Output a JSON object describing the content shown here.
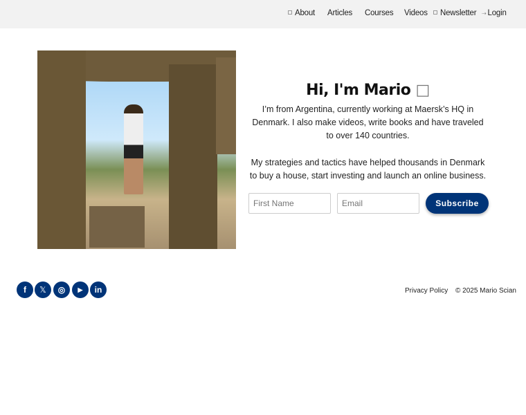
{
  "nav": {
    "about": "About",
    "articles": "Articles",
    "courses": "Courses",
    "videos": "Videos",
    "newsletter": "Newsletter",
    "login": "Login"
  },
  "hero": {
    "title": "Hi, I'm Mario",
    "title_icon": "□",
    "para1": "I’m from      Argentina, currently working at Maersk’s HQ in Denmark. I also make videos, write books and have traveled to over 140 countries.",
    "para2": "My strategies and tactics have helped thousands in Denmark to buy a house, start investing and launch an online business.",
    "first_name_placeholder": "First Name",
    "email_placeholder": "Email",
    "subscribe": "Subscribe"
  },
  "footer": {
    "social": {
      "facebook": "f",
      "x": "𝕏",
      "instagram": "◎",
      "youtube": "▶",
      "linkedin": "in"
    },
    "privacy": "Privacy Policy",
    "copyright": "© 2025 Mario Scian"
  },
  "colors": {
    "accent": "#003478",
    "nav_bg": "#f2f2f2"
  }
}
